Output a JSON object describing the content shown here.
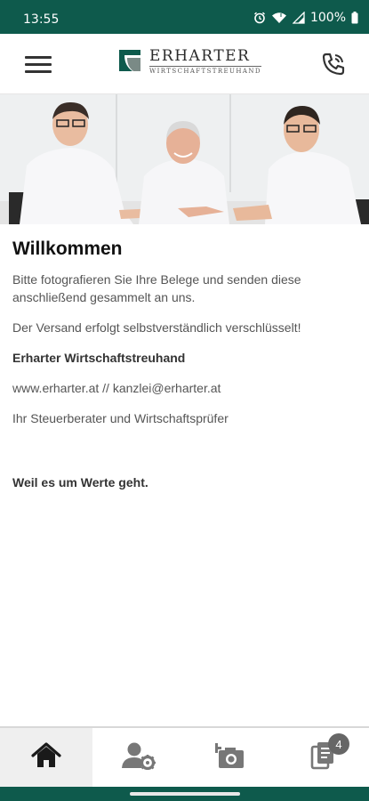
{
  "status_bar": {
    "time": "13:55",
    "battery": "100%"
  },
  "header": {
    "menu_icon": "hamburger-menu-icon",
    "logo": {
      "name": "ERHARTER",
      "subtitle": "WIRTSCHAFTSTREUHAND"
    },
    "phone_icon": "phone-icon"
  },
  "hero": {
    "image": "photo-three-men-at-table"
  },
  "main": {
    "title": "Willkommen",
    "intro": "Bitte fotografieren Sie Ihre Belege und senden diese anschließend gesammelt an uns.",
    "encryption_note": "Der Versand erfolgt selbstverständlich verschlüsselt!",
    "company": "Erharter Wirtschaftstreuhand",
    "contact": "www.erharter.at // kanzlei@erharter.at",
    "role": "Ihr Steuerberater und Wirtschaftsprüfer",
    "slogan": "Weil es um Werte geht."
  },
  "bottom_nav": {
    "items": [
      {
        "icon": "home-icon",
        "active": true
      },
      {
        "icon": "user-settings-icon",
        "active": false
      },
      {
        "icon": "add-photo-icon",
        "active": false
      },
      {
        "icon": "documents-icon",
        "active": false,
        "badge": "4"
      }
    ]
  },
  "colors": {
    "brand_green": "#0e5a4c",
    "nav_active_bg": "#efefef",
    "badge_bg": "#666666"
  }
}
